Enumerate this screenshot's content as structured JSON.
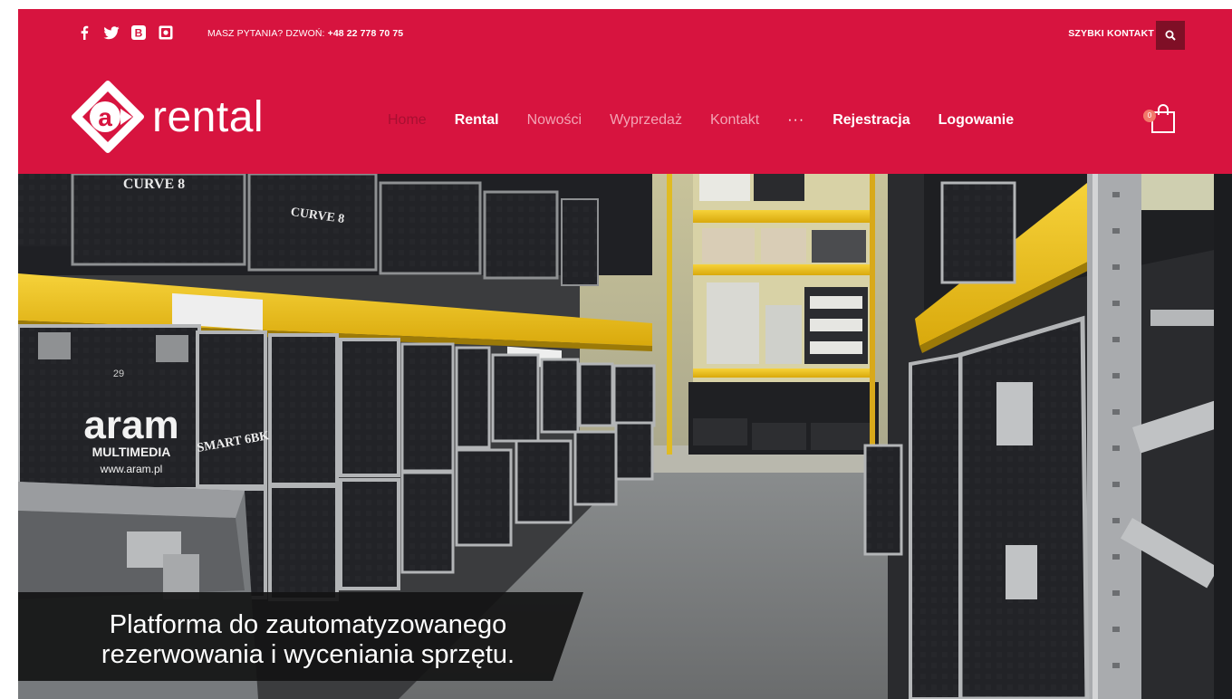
{
  "header": {
    "social": [
      {
        "name": "facebook-icon",
        "glyph": "f"
      },
      {
        "name": "twitter-icon",
        "glyph": "bird"
      },
      {
        "name": "behance-icon",
        "glyph": "B"
      },
      {
        "name": "instagram-icon",
        "glyph": "camera"
      }
    ],
    "phone_prefix": "MASZ PYTANIA? DZWOŃ: ",
    "phone_number": "+48 22 778 70 75",
    "quick_contact": "SZYBKI KONTAKT",
    "logo_text": "rental",
    "logo_mark_letter": "a",
    "nav": [
      {
        "label": "Home",
        "state": "active"
      },
      {
        "label": "Rental",
        "state": "bold"
      },
      {
        "label": "Nowości",
        "state": "normal"
      },
      {
        "label": "Wyprzedaż",
        "state": "normal"
      },
      {
        "label": "Kontakt",
        "state": "normal"
      },
      {
        "label": "···",
        "state": "more"
      },
      {
        "label": "Rejestracja",
        "state": "bold"
      },
      {
        "label": "Logowanie",
        "state": "bold"
      }
    ],
    "cart_count": "0",
    "icons": {
      "search": "search-icon",
      "cart": "shopping-bag-icon"
    }
  },
  "hero": {
    "caption_line1": "Platforma do zautomatyzowanego",
    "caption_line2": "rezerwowania i wyceniania sprzętu.",
    "photo_labels": {
      "case_top_left": "CURVE 8",
      "case_top_left2": "CURVE 8",
      "brand": "aram",
      "brand_sub": "MULTIMEDIA",
      "brand_url": "www.aram.pl",
      "case_model": "SMART 6BK",
      "case_number": "29"
    }
  },
  "colors": {
    "brand": "#d7143f",
    "search_bg": "#7f0f26",
    "nav_inactive": "#f3a3b4",
    "nav_active": "#a80f31",
    "shelf_yellow": "#f2c21b",
    "case_black": "#1e1f22",
    "caption_bg": "#141414"
  }
}
